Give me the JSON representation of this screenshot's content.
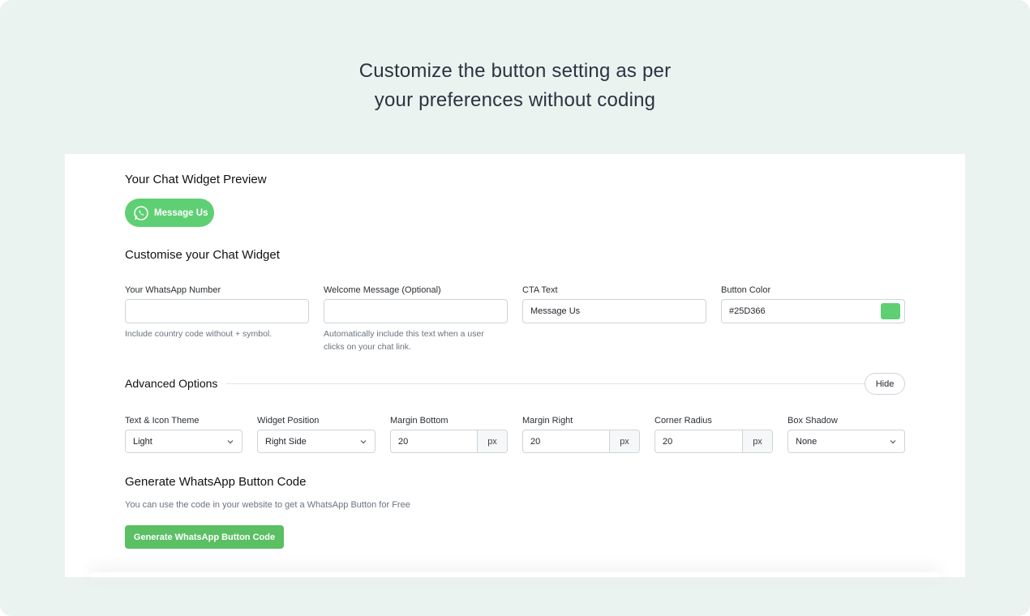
{
  "headline": {
    "line1": "Customize the button setting as per",
    "line2": "your preferences without coding"
  },
  "preview": {
    "title": "Your Chat Widget Preview",
    "button_label": "Message Us",
    "button_icon": "whatsapp-icon"
  },
  "customise": {
    "title": "Customise your Chat Widget",
    "fields": {
      "whatsapp_number": {
        "label": "Your WhatsApp Number",
        "value": "",
        "help": "Include country code without + symbol."
      },
      "welcome_message": {
        "label": "Welcome Message (Optional)",
        "value": "",
        "help_line1": "Automatically include this text when a user",
        "help_line2": "clicks on your chat link."
      },
      "cta_text": {
        "label": "CTA Text",
        "value": "Message Us"
      },
      "button_color": {
        "label": "Button Color",
        "value": "#25D366",
        "swatch": "#5fcf73"
      }
    }
  },
  "advanced": {
    "title": "Advanced Options",
    "toggle_label": "Hide",
    "theme": {
      "label": "Text & Icon Theme",
      "value": "Light"
    },
    "position": {
      "label": "Widget Position",
      "value": "Right Side"
    },
    "margin_bottom": {
      "label": "Margin Bottom",
      "value": "20",
      "unit": "px"
    },
    "margin_right": {
      "label": "Margin Right",
      "value": "20",
      "unit": "px"
    },
    "corner_radius": {
      "label": "Corner Radius",
      "value": "20",
      "unit": "px"
    },
    "box_shadow": {
      "label": "Box Shadow",
      "value": "None"
    }
  },
  "generate": {
    "title": "Generate WhatsApp Button Code",
    "description": "You can use the code in your website to get a WhatsApp Button for Free",
    "button_label": "Generate WhatsApp Button Code"
  },
  "colors": {
    "background": "#ebf3f1",
    "accent_green": "#5bbf64",
    "preview_green": "#5fcf73"
  }
}
